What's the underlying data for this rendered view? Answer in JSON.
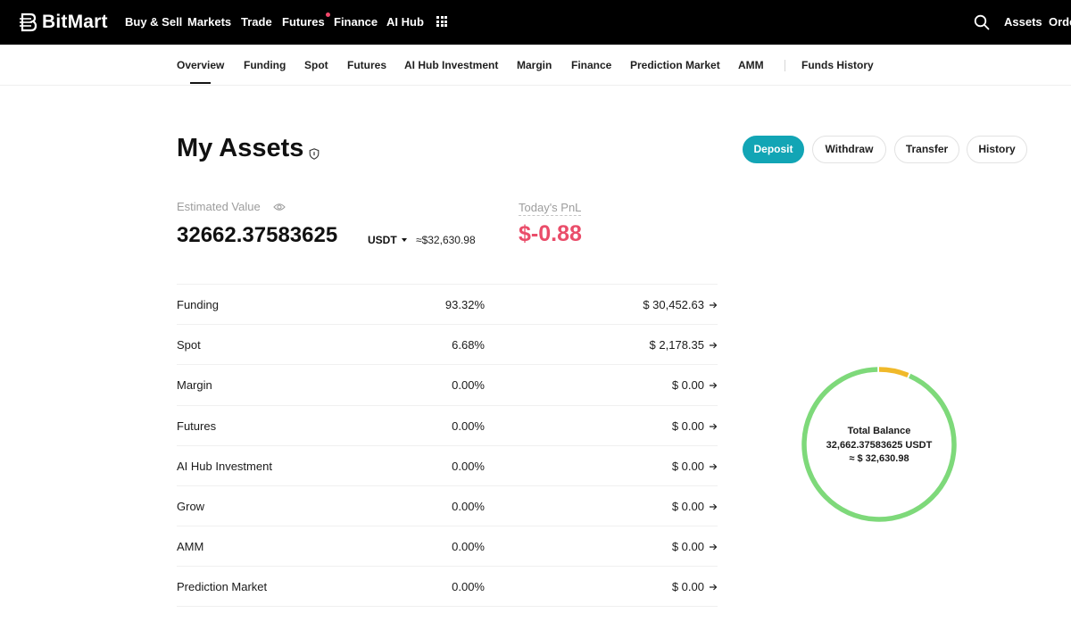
{
  "brand": {
    "name": "BitMart"
  },
  "topnav": {
    "items": [
      "Buy & Sell",
      "Markets",
      "Trade",
      "Futures",
      "Finance",
      "AI Hub"
    ],
    "right": [
      "Assets",
      "Orde"
    ]
  },
  "subnav": {
    "tabs": [
      "Overview",
      "Funding",
      "Spot",
      "Futures",
      "AI Hub Investment",
      "Margin",
      "Finance",
      "Prediction Market",
      "AMM"
    ],
    "funds_history": "Funds History",
    "active_tab": "Overview"
  },
  "header": {
    "title": "My Assets",
    "buttons": {
      "deposit": "Deposit",
      "withdraw": "Withdraw",
      "transfer": "Transfer",
      "history": "History"
    }
  },
  "summary": {
    "estimated_label": "Estimated Value",
    "estimated_value": "32662.37583625",
    "unit": "USDT",
    "approx": "≈$32,630.98",
    "pnl_label": "Today's PnL",
    "pnl_value": "$-0.88"
  },
  "accounts": [
    {
      "name": "Funding",
      "percent": "93.32%",
      "value": "$ 30,452.63"
    },
    {
      "name": "Spot",
      "percent": "6.68%",
      "value": "$ 2,178.35"
    },
    {
      "name": "Margin",
      "percent": "0.00%",
      "value": "$ 0.00"
    },
    {
      "name": "Futures",
      "percent": "0.00%",
      "value": "$ 0.00"
    },
    {
      "name": "AI Hub Investment",
      "percent": "0.00%",
      "value": "$ 0.00"
    },
    {
      "name": "Grow",
      "percent": "0.00%",
      "value": "$ 0.00"
    },
    {
      "name": "AMM",
      "percent": "0.00%",
      "value": "$ 0.00"
    },
    {
      "name": "Prediction Market",
      "percent": "0.00%",
      "value": "$ 0.00"
    }
  ],
  "balance_chart": {
    "title": "Total Balance",
    "total": "32,662.37583625 USDT",
    "approx": "≈ $ 32,630.98",
    "segments": [
      {
        "share": 0.9332,
        "color": "#7ed97a"
      },
      {
        "share": 0.0668,
        "color": "#f0b92a"
      }
    ]
  },
  "colors": {
    "accent": "#12a5b5",
    "negative": "#ea4d6a"
  }
}
